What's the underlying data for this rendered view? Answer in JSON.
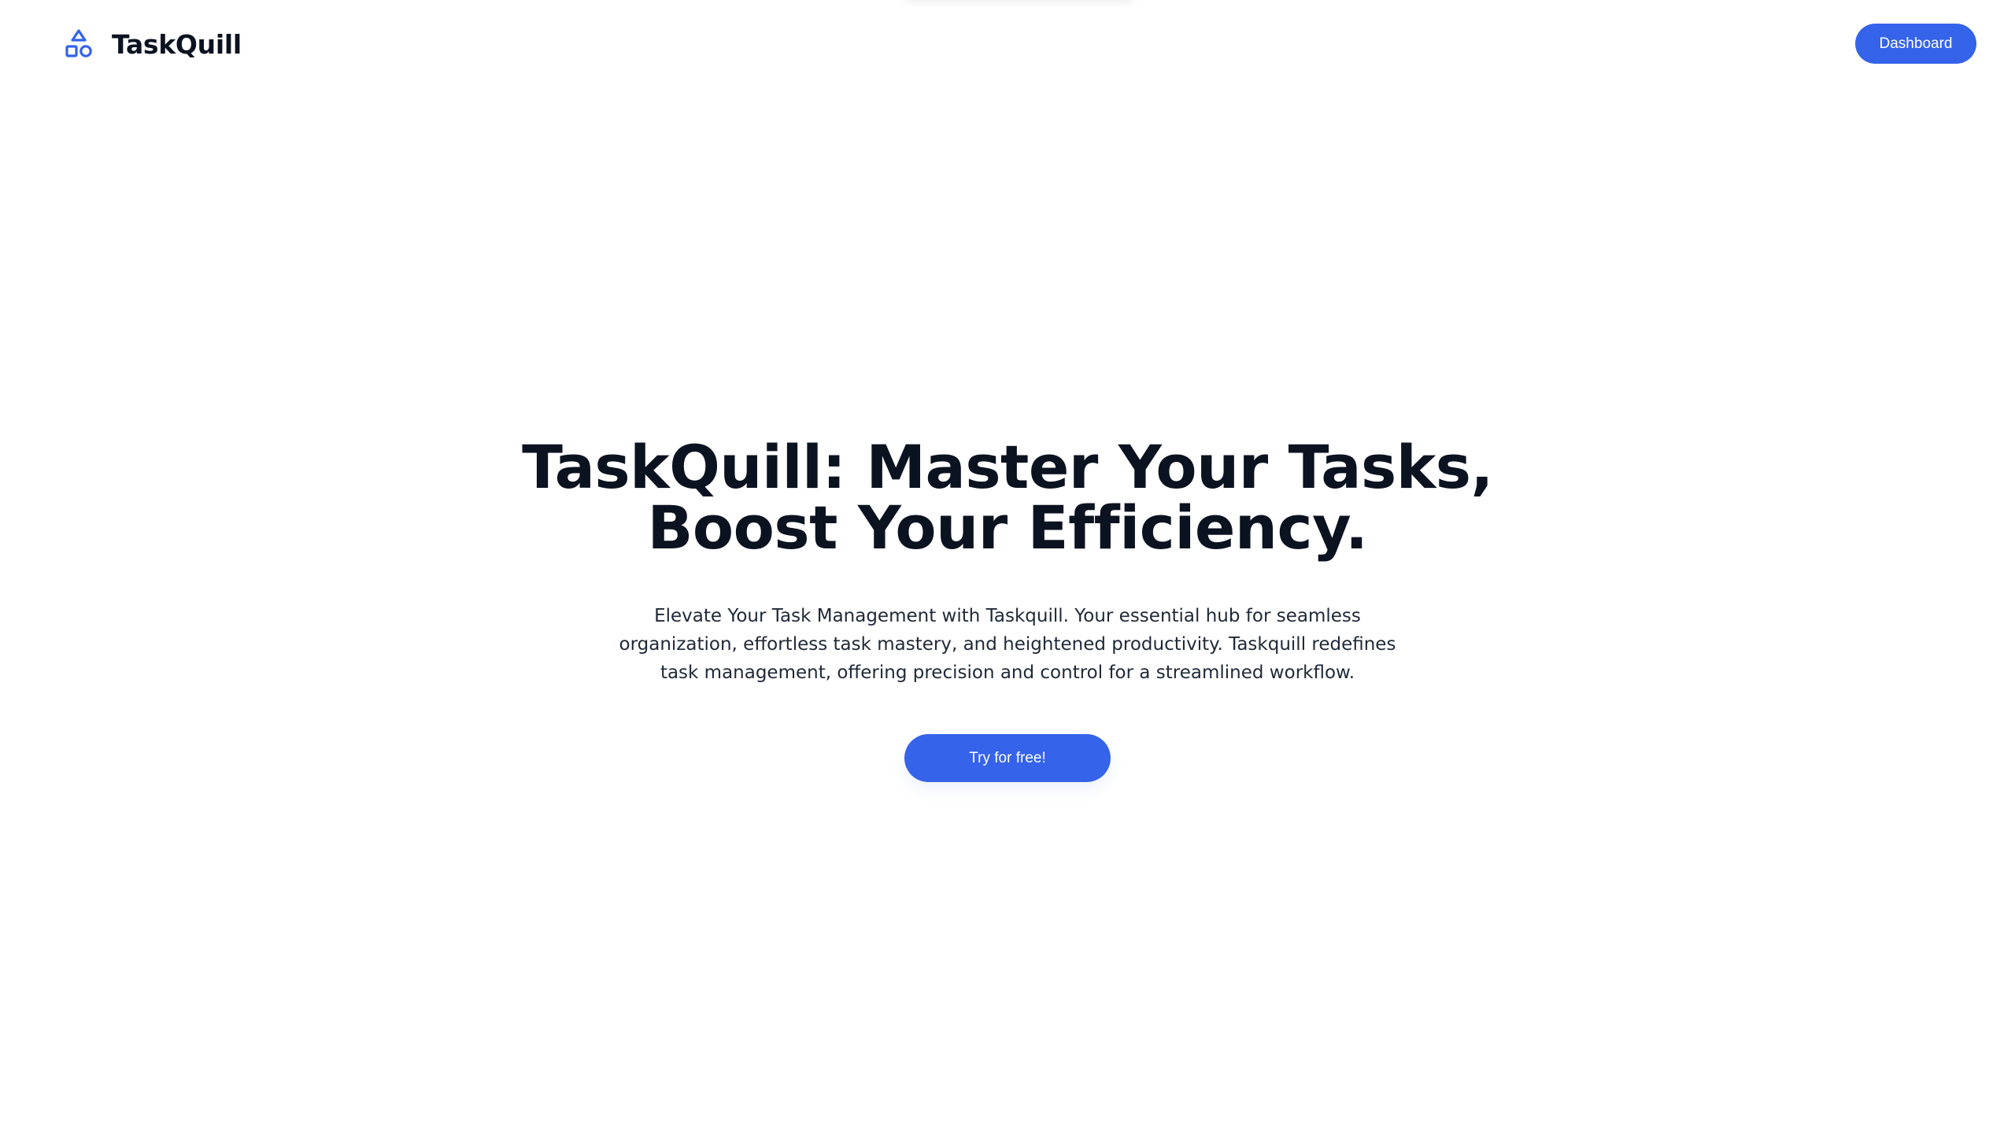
{
  "brand": {
    "name": "TaskQuill",
    "icon": "shapes-icon",
    "accent_color": "#3563e9"
  },
  "nav": {
    "dashboard_label": "Dashboard"
  },
  "hero": {
    "title_line1": "TaskQuill: Master Your Tasks,",
    "title_line2": "Boost Your Efficiency.",
    "description": "Elevate Your Task Management with Taskquill. Your essential hub for seamless organization, effortless task mastery, and heightened productivity. Taskquill redefines task management, offering precision and control for a streamlined workflow.",
    "cta_label": "Try for free!"
  }
}
